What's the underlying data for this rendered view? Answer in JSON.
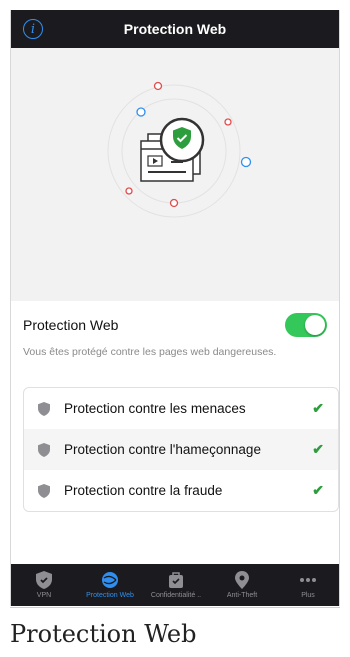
{
  "header": {
    "title": "Protection Web",
    "info_icon": "info-icon"
  },
  "toggle": {
    "label": "Protection Web",
    "on": true,
    "description": "Vous êtes protégé contre les pages web dangereuses."
  },
  "features": [
    {
      "label": "Protection contre les menaces",
      "icon": "shield-icon",
      "status": "✔"
    },
    {
      "label": "Protection contre l'hameçonnage",
      "icon": "shield-icon",
      "status": "✔"
    },
    {
      "label": "Protection contre la fraude",
      "icon": "shield-icon",
      "status": "✔"
    }
  ],
  "tabs": [
    {
      "label": "VPN",
      "icon": "vpn-shield-icon"
    },
    {
      "label": "Protection Web",
      "icon": "web-protection-icon",
      "active": true
    },
    {
      "label": "Confidentialité ..",
      "icon": "privacy-icon"
    },
    {
      "label": "Anti-Theft",
      "icon": "location-pin-icon"
    },
    {
      "label": "Plus",
      "icon": "more-dots-icon"
    }
  ],
  "caption": "Protection Web",
  "colors": {
    "accent": "#2f8ff0",
    "toggle_on": "#34c759",
    "check": "#2e9d3e",
    "bar": "#1b1b1f"
  }
}
